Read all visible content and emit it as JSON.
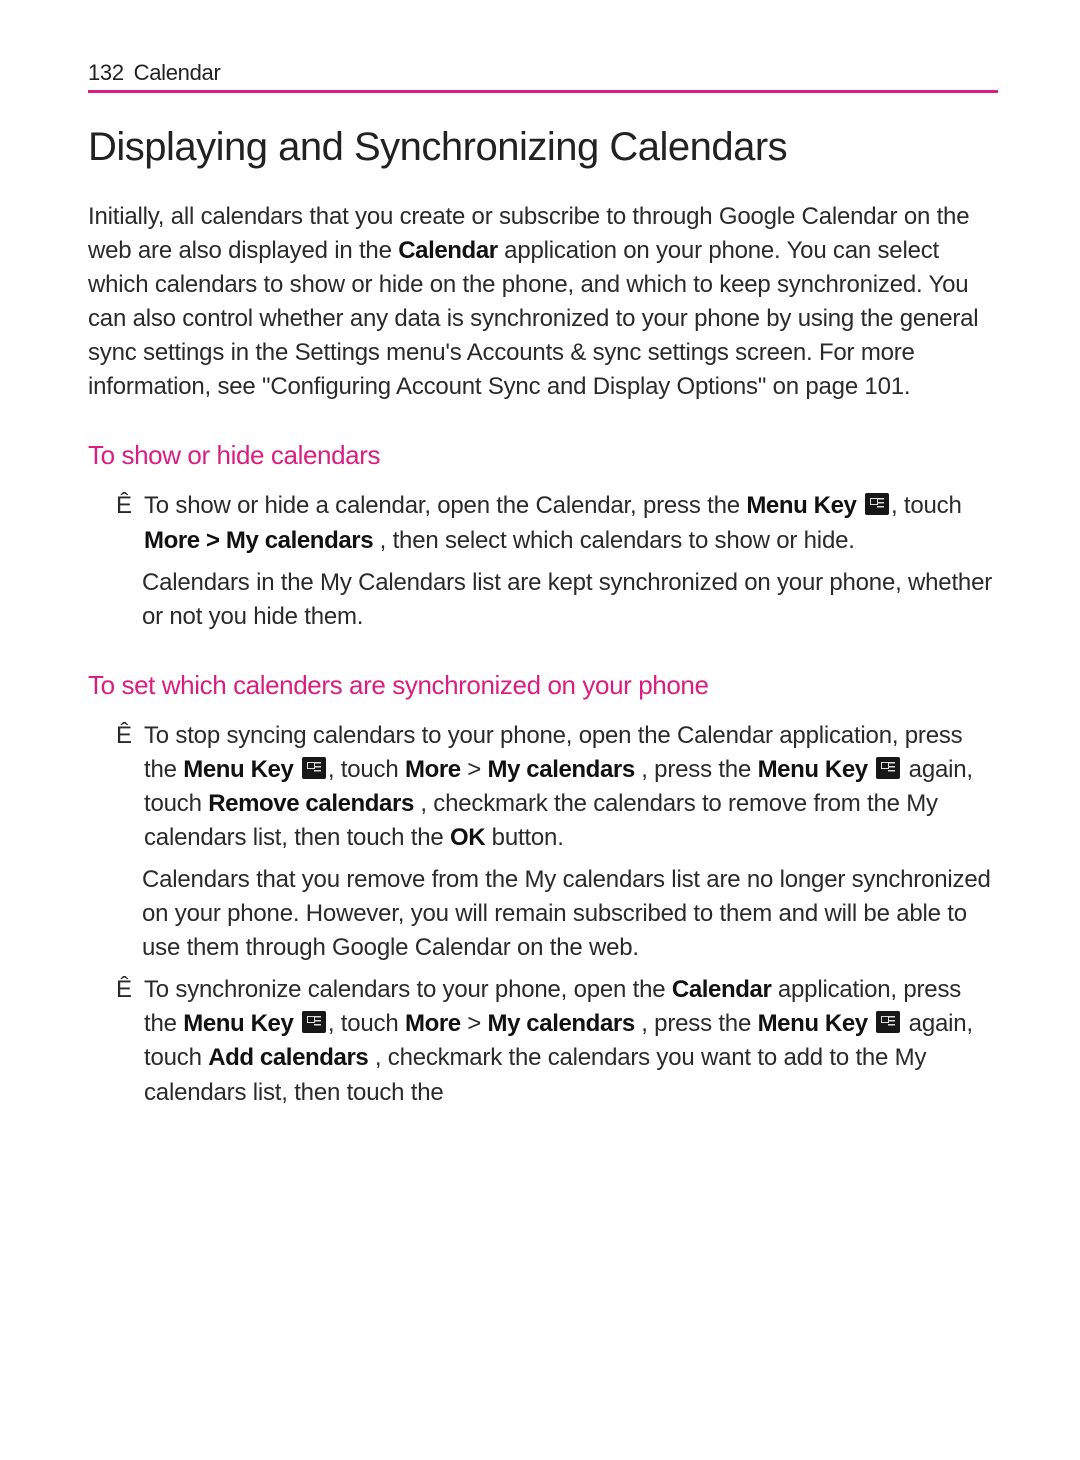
{
  "header": {
    "page_number": "132",
    "section": "Calendar"
  },
  "title": "Displaying and Synchronizing Calendars",
  "intro": {
    "t1": "Initially, all calendars that you create or subscribe to through Google Calendar on the web are also displayed in the ",
    "b1": "Calendar",
    "t2": " application on your phone. You can select which calendars to show or hide on the phone, and which to keep synchronized. You can also control whether any data is synchronized to your phone by using the general sync settings in the Settings menu's Accounts & sync settings screen. For more information, see \"Configuring Account Sync and Display Options\" on page 101."
  },
  "sec1_heading": "To show or hide calendars",
  "sec1_bullet": {
    "marker": "Ê",
    "t1": "To show or hide a calendar, open the Calendar, press the ",
    "b1": "Menu Key",
    "t2": " ",
    "t3": ", touch ",
    "b2": "More > My calendars",
    "t4": " , then select which calendars to show or hide.",
    "cont": "Calendars in the My Calendars list are kept synchronized on your phone, whether or not you hide them."
  },
  "sec2_heading": "To set which calenders are synchronized on your phone",
  "sec2_b1": {
    "marker": "Ê",
    "t1": "To stop syncing calendars to your phone, open the Calendar application, press the ",
    "b1": "Menu Key",
    "t2": " ",
    "t3": ", touch ",
    "b2": "More",
    "t4": "  > ",
    "b3": "My calendars",
    "t5": " , press the ",
    "b4": "Menu Key",
    "t6": " ",
    "t7": " again, touch ",
    "b5": "Remove calendars",
    "t8": " , checkmark the calendars to remove from the My calendars list, then touch the ",
    "b6": "OK",
    "t9": " button.",
    "cont": "Calendars that you remove from the My calendars list are no longer synchronized on your phone. However, you will remain subscribed to them and will be able to use them through Google Calendar on the web."
  },
  "sec2_b2": {
    "marker": "Ê",
    "t1": "To synchronize calendars to your phone, open the ",
    "b1": "Calendar",
    "t2": " application, press the ",
    "b2": "Menu Key",
    "t3": " ",
    "t4": ", touch ",
    "b3": "More",
    "t5": "  > ",
    "b4": "My calendars",
    "t6": " , press the ",
    "b5": "Menu Key",
    "t7": " ",
    "t8": " again, touch ",
    "b6": "Add calendars",
    "t9": " , checkmark the calendars you want to add to the My calendars list, then touch the"
  }
}
